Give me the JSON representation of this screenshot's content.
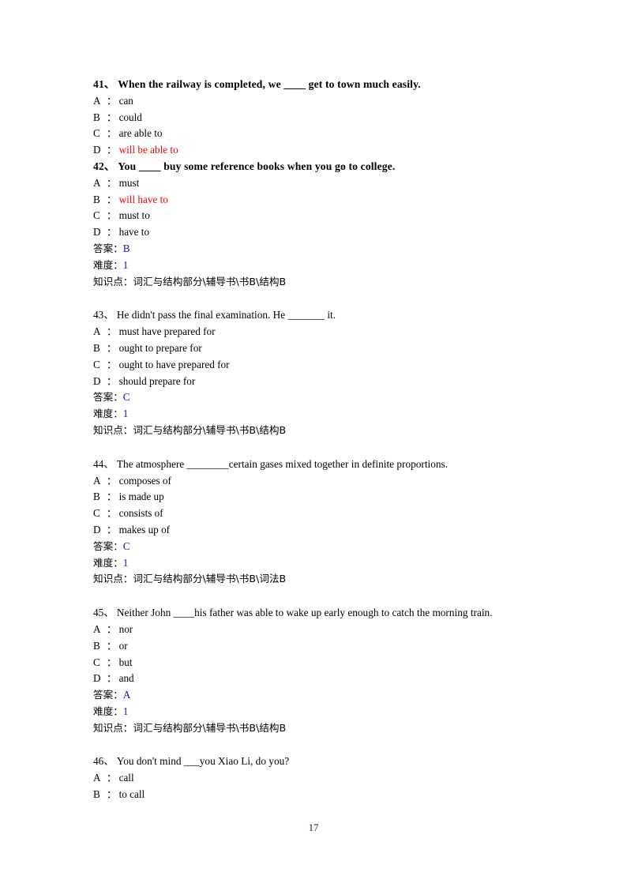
{
  "document": {
    "page_number": "17",
    "answer_label": "答案：",
    "difficulty_label": "难度：",
    "knowledge_label": "知识点：",
    "highlight_color": "#ff0000"
  },
  "questions": [
    {
      "number": "41、",
      "stem": "When the railway is completed, we ____ get to town much easily.",
      "bold": true,
      "options": [
        {
          "label": "A",
          "sep": "：",
          "text": "can",
          "highlighted": false
        },
        {
          "label": "B",
          "sep": "：",
          "text": "could",
          "highlighted": false
        },
        {
          "label": "C",
          "sep": "：",
          "text": "are able to",
          "highlighted": false
        },
        {
          "label": "D",
          "sep": "：",
          "text": "will be able to",
          "highlighted": true
        }
      ],
      "meta": null
    },
    {
      "number": "42、",
      "stem": "You ____ buy some reference books when you go to college.",
      "bold": true,
      "options": [
        {
          "label": "A",
          "sep": "：",
          "text": "must",
          "highlighted": false
        },
        {
          "label": "B",
          "sep": "：",
          "text": "will have to",
          "highlighted": true
        },
        {
          "label": "C",
          "sep": "：",
          "text": "must to",
          "highlighted": false
        },
        {
          "label": "D",
          "sep": "：",
          "text": "have to",
          "highlighted": false
        }
      ],
      "meta": {
        "answer": "B",
        "difficulty": "1",
        "knowledge": "词汇与结构部分\\辅导书\\书B\\结构B"
      }
    },
    {
      "number": "43、",
      "stem": "He didn't pass the final examination. He _______ it.",
      "bold": false,
      "options": [
        {
          "label": "A",
          "sep": "：",
          "text": "must have prepared for",
          "highlighted": false
        },
        {
          "label": "B",
          "sep": "：",
          "text": "ought to prepare for",
          "highlighted": false
        },
        {
          "label": "C",
          "sep": "：",
          "text": "ought to have prepared for",
          "highlighted": false
        },
        {
          "label": "D",
          "sep": "：",
          "text": "should prepare for",
          "highlighted": false
        }
      ],
      "meta": {
        "answer": "C",
        "difficulty": "1",
        "knowledge": "词汇与结构部分\\辅导书\\书B\\结构B"
      }
    },
    {
      "number": "44、",
      "stem": "The atmosphere ________certain gases mixed together in definite proportions.",
      "bold": false,
      "options": [
        {
          "label": "A",
          "sep": "：",
          "text": "composes of",
          "highlighted": false
        },
        {
          "label": "B",
          "sep": "：",
          "text": "is made up",
          "highlighted": false
        },
        {
          "label": "C",
          "sep": "：",
          "text": "consists of",
          "highlighted": false
        },
        {
          "label": "D",
          "sep": "：",
          "text": "makes up of",
          "highlighted": false
        }
      ],
      "meta": {
        "answer": "C",
        "difficulty": "1",
        "knowledge": "词汇与结构部分\\辅导书\\书B\\词法B"
      }
    },
    {
      "number": "45、",
      "stem": "Neither John ____his father was able to wake up early enough to catch the morning train.",
      "bold": false,
      "options": [
        {
          "label": "A",
          "sep": "：",
          "text": "nor",
          "highlighted": false
        },
        {
          "label": "B",
          "sep": "：",
          "text": "or",
          "highlighted": false
        },
        {
          "label": "C",
          "sep": "：",
          "text": "but",
          "highlighted": false
        },
        {
          "label": "D",
          "sep": "：",
          "text": "and",
          "highlighted": false
        }
      ],
      "meta": {
        "answer": "A",
        "difficulty": "1",
        "knowledge": "词汇与结构部分\\辅导书\\书B\\结构B"
      }
    },
    {
      "number": "46、",
      "stem": "You don't mind ___you Xiao Li, do you?",
      "bold": false,
      "options": [
        {
          "label": "A",
          "sep": "：",
          "text": "call",
          "highlighted": false
        },
        {
          "label": "B",
          "sep": "：",
          "text": "to call",
          "highlighted": false
        }
      ],
      "meta": null
    }
  ]
}
